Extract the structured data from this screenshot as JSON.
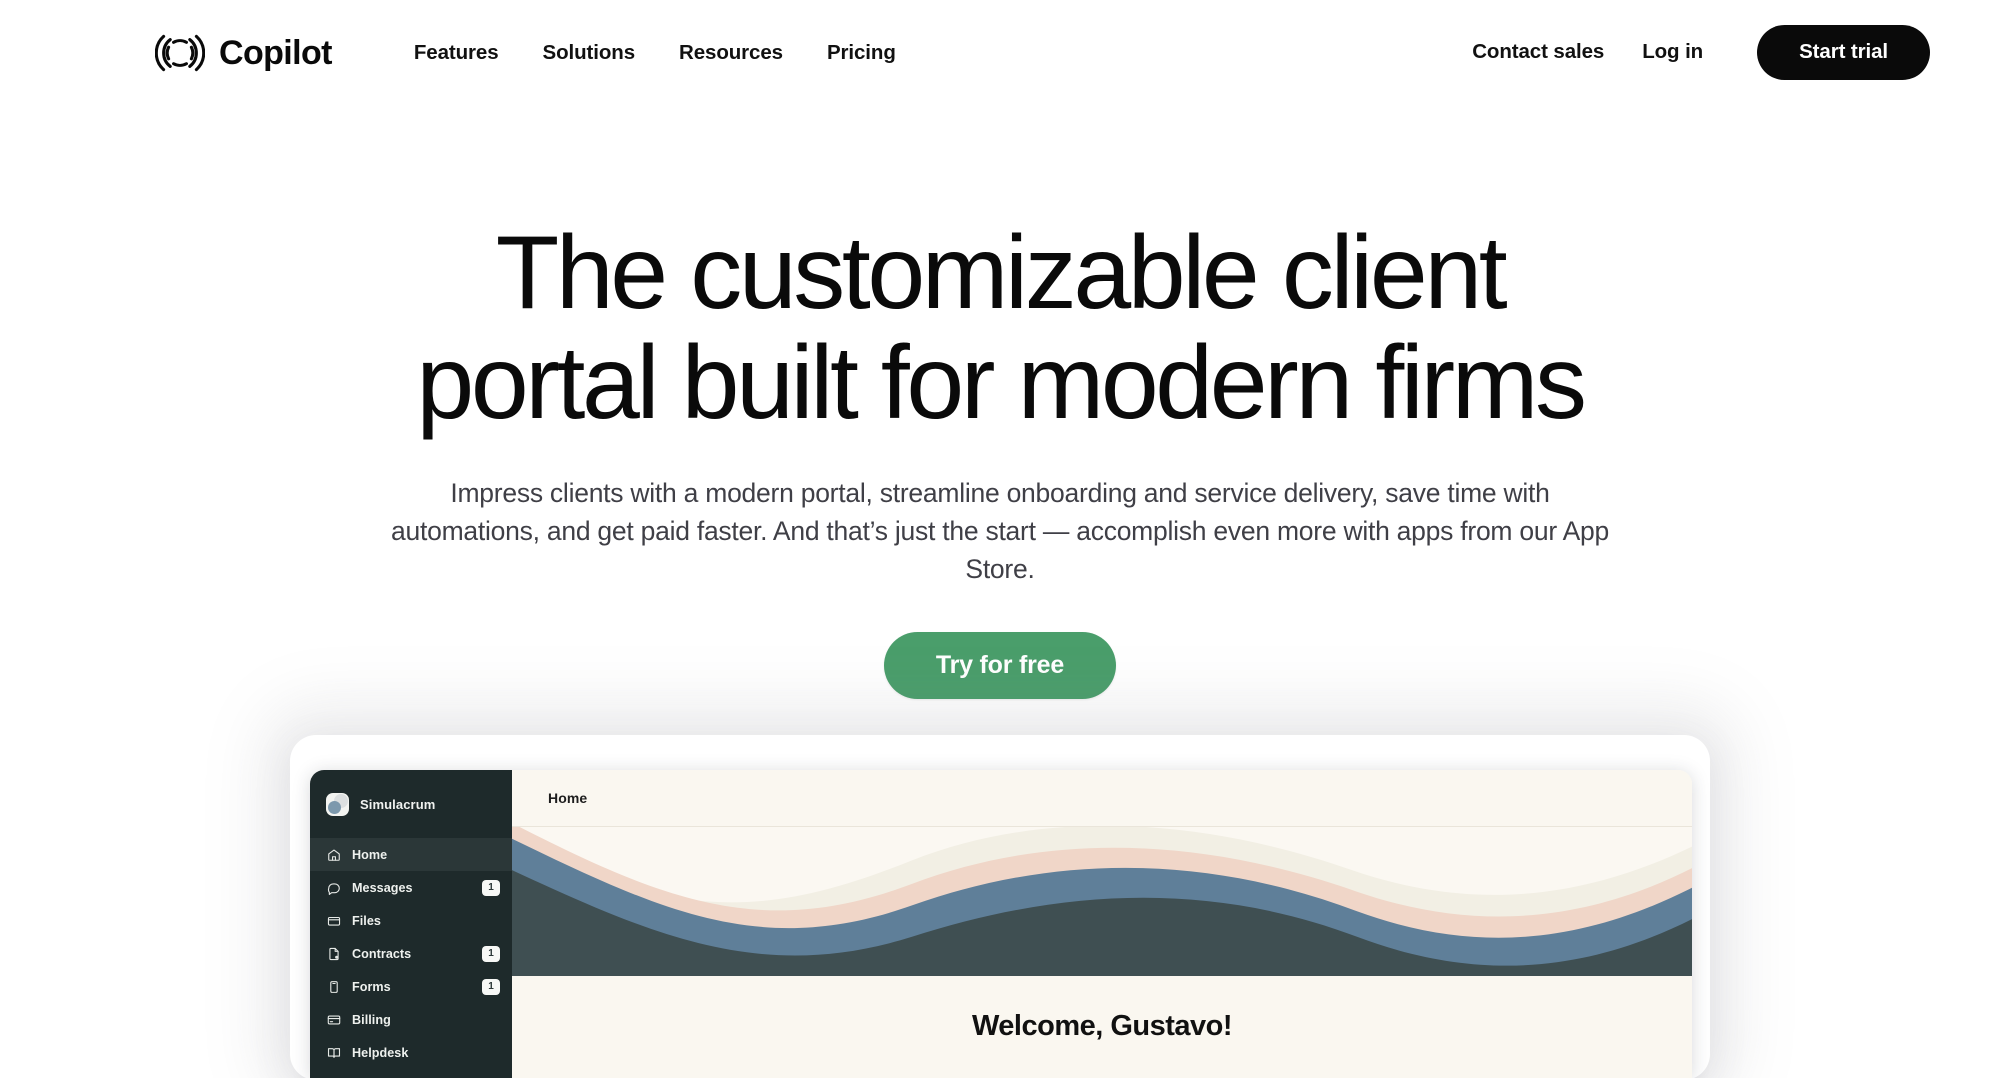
{
  "header": {
    "brand": {
      "name": "Copilot",
      "logo_icon": "copilot-circle-icon"
    },
    "nav": [
      {
        "label": "Features"
      },
      {
        "label": "Solutions"
      },
      {
        "label": "Resources"
      },
      {
        "label": "Pricing"
      }
    ],
    "contact_sales_label": "Contact sales",
    "login_label": "Log in",
    "start_trial_label": "Start trial"
  },
  "hero": {
    "title_line1": "The customizable client",
    "title_line2": "portal built for modern firms",
    "subtitle": "Impress clients with a modern portal, streamline onboarding and service delivery, save time with automations, and get paid faster. And that’s just the start — accomplish even more with apps from our App Store.",
    "cta_label": "Try for free",
    "cta_color": "#4a9e6b"
  },
  "app_preview": {
    "workspace": {
      "name": "Simulacrum",
      "avatar_icon": "workspace-avatar-icon"
    },
    "sidebar_items": [
      {
        "label": "Home",
        "icon": "home-icon",
        "badge": "",
        "active": true
      },
      {
        "label": "Messages",
        "icon": "chat-bubble-icon",
        "badge": "1",
        "active": false
      },
      {
        "label": "Files",
        "icon": "folder-icon",
        "badge": "",
        "active": false
      },
      {
        "label": "Contracts",
        "icon": "contract-document-icon",
        "badge": "1",
        "active": false
      },
      {
        "label": "Forms",
        "icon": "clipboard-icon",
        "badge": "1",
        "active": false
      },
      {
        "label": "Billing",
        "icon": "credit-card-icon",
        "badge": "",
        "active": false
      },
      {
        "label": "Helpdesk",
        "icon": "book-icon",
        "badge": "",
        "active": false
      }
    ],
    "topbar_title": "Home",
    "welcome_text": "Welcome, Gustavo!",
    "banner_colors": {
      "background": "#fbf8f2",
      "wave_cream": "#f4f1e7",
      "wave_peach": "#f0d6c8",
      "wave_blue": "#5f7f99",
      "wave_slate": "#3f4f52"
    }
  }
}
